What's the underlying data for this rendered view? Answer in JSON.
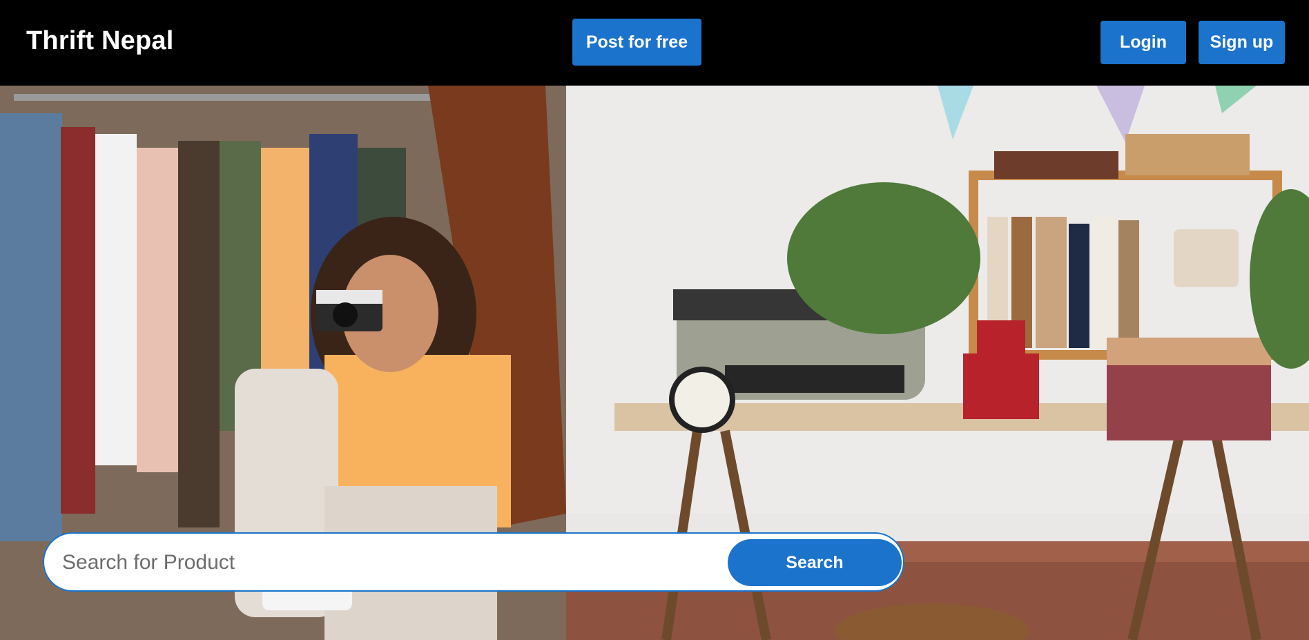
{
  "header": {
    "brand": "Thrift Nepal",
    "post_label": "Post for free",
    "login_label": "Login",
    "signup_label": "Sign up"
  },
  "search": {
    "placeholder": "Search for Product",
    "value": "",
    "button_label": "Search"
  },
  "colors": {
    "navbar_bg": "#000000",
    "accent": "#1b73cc",
    "text_on_accent": "#ffffff"
  }
}
